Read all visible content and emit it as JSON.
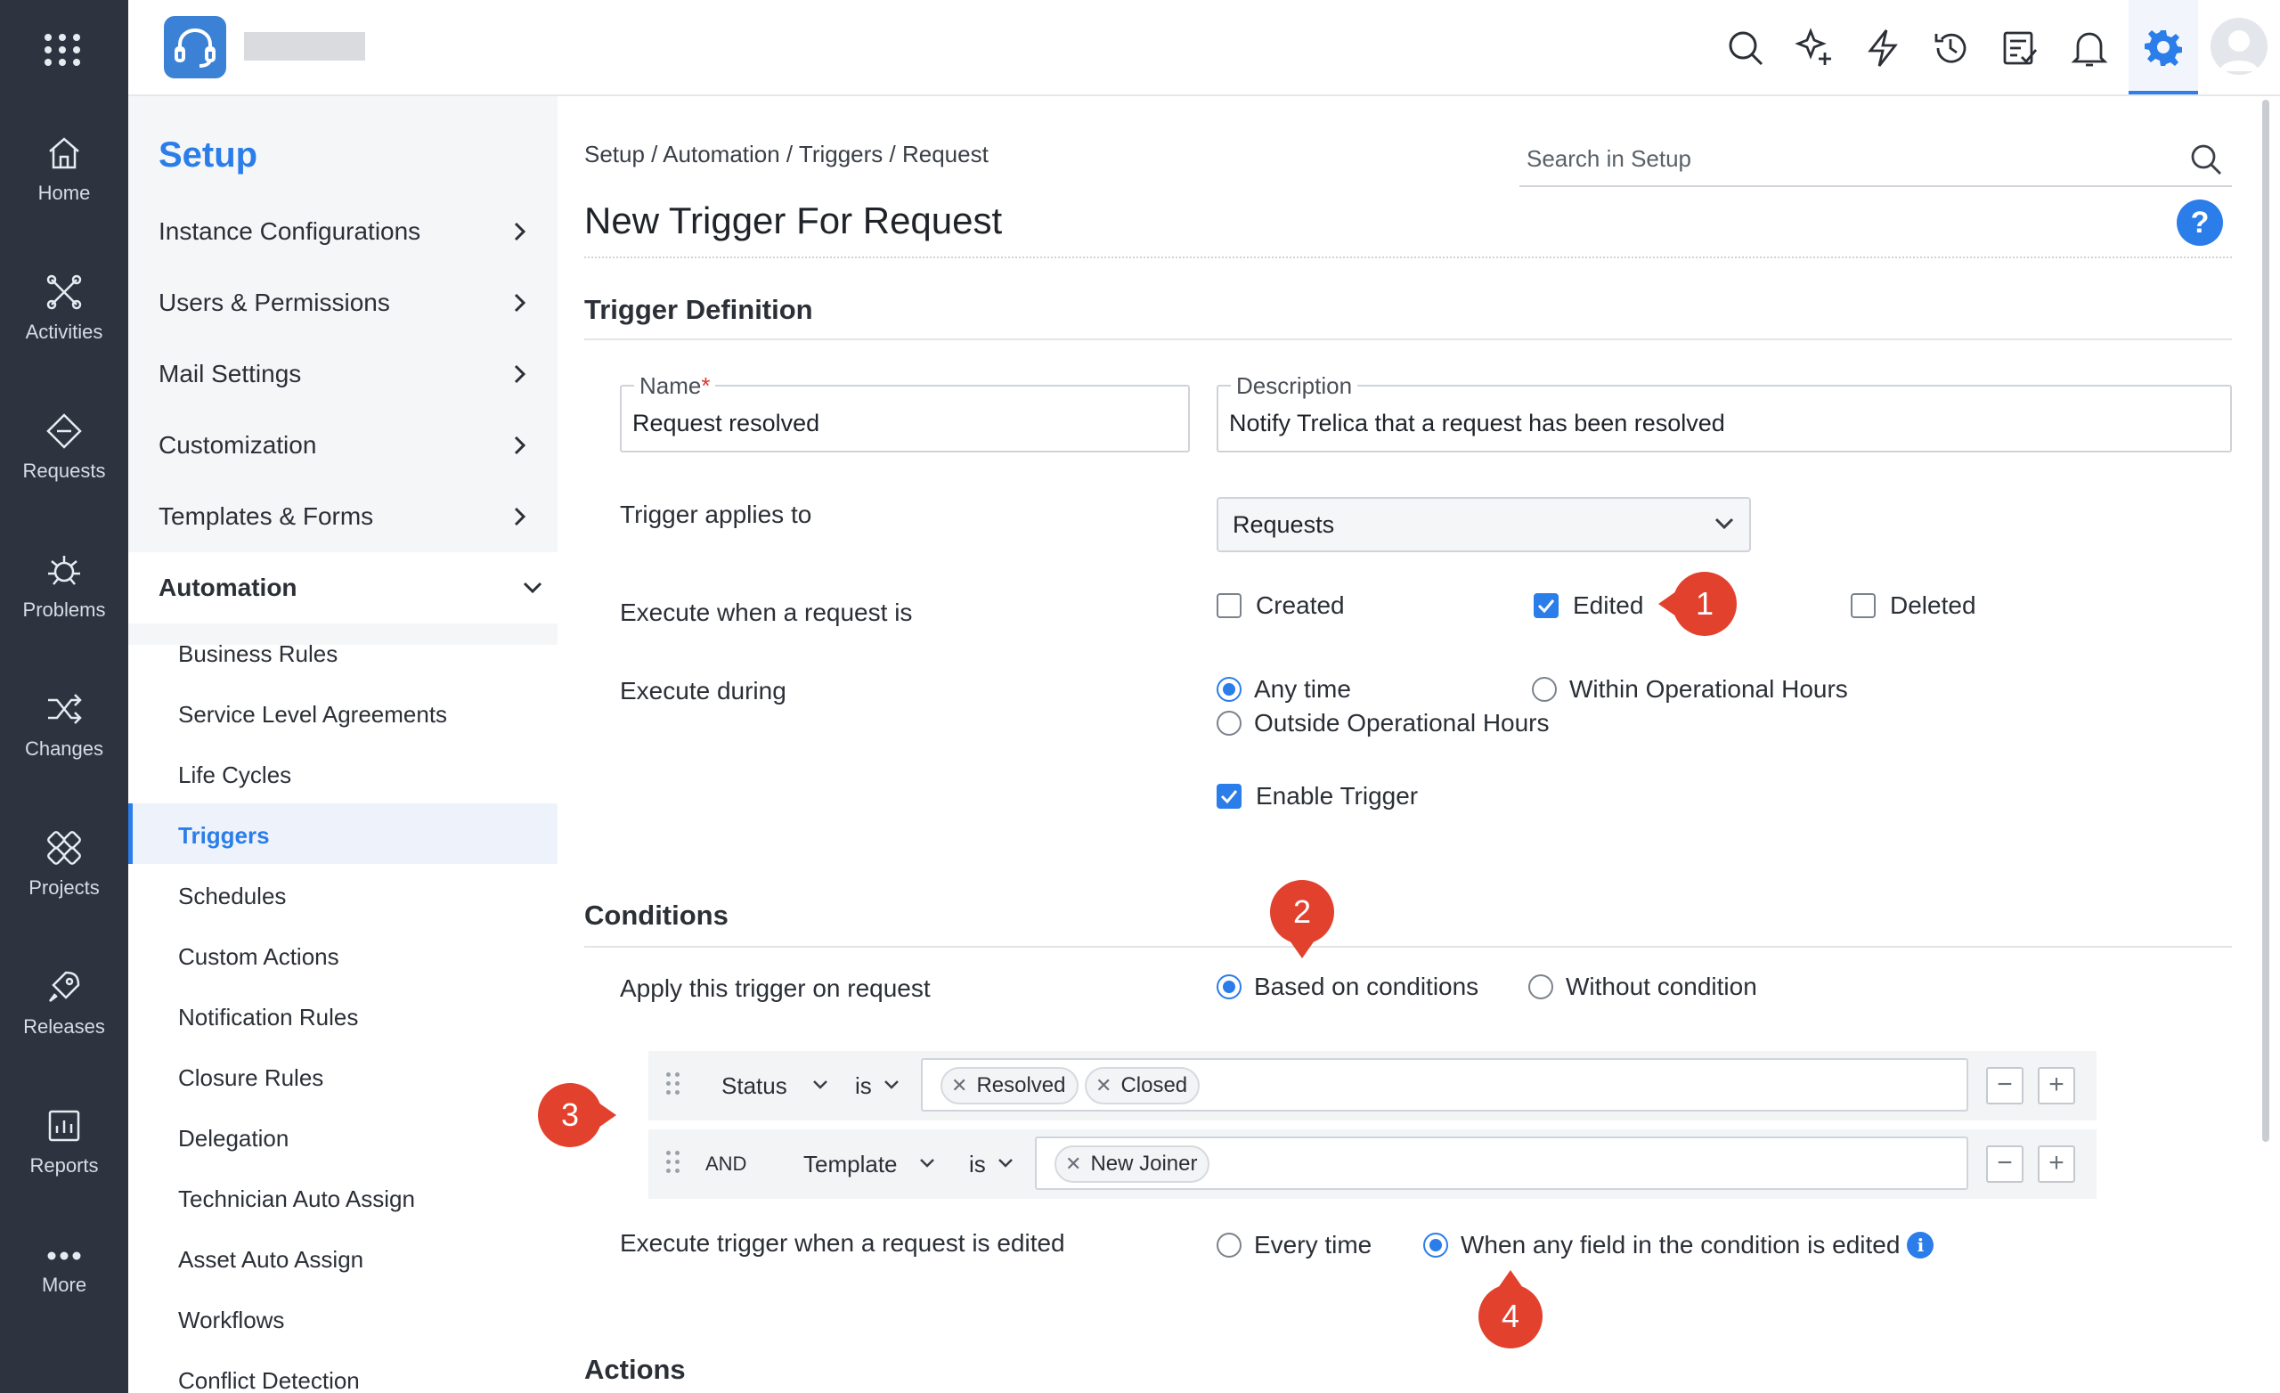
{
  "rail": {
    "items": [
      {
        "label": "Home",
        "icon": "home-icon"
      },
      {
        "label": "Activities",
        "icon": "activities-icon"
      },
      {
        "label": "Requests",
        "icon": "requests-icon"
      },
      {
        "label": "Problems",
        "icon": "problems-icon"
      },
      {
        "label": "Changes",
        "icon": "changes-icon"
      },
      {
        "label": "Projects",
        "icon": "projects-icon"
      },
      {
        "label": "Releases",
        "icon": "releases-icon"
      },
      {
        "label": "Reports",
        "icon": "reports-icon"
      },
      {
        "label": "More",
        "icon": "more-icon"
      }
    ]
  },
  "topbar": {
    "icons": [
      "search-icon",
      "ai-sparkle-icon",
      "quick-actions-icon",
      "history-icon",
      "tasks-icon",
      "notifications-icon",
      "settings-icon",
      "user-avatar"
    ],
    "accent": "#2f7fe6"
  },
  "setup": {
    "title": "Setup",
    "menu": [
      {
        "label": "Instance Configurations"
      },
      {
        "label": "Users & Permissions"
      },
      {
        "label": "Mail Settings"
      },
      {
        "label": "Customization"
      },
      {
        "label": "Templates & Forms"
      }
    ],
    "automation_label": "Automation",
    "automation_items": [
      {
        "label": "Business Rules"
      },
      {
        "label": "Service Level Agreements"
      },
      {
        "label": "Life Cycles"
      },
      {
        "label": "Triggers"
      },
      {
        "label": "Schedules"
      },
      {
        "label": "Custom Actions"
      },
      {
        "label": "Notification Rules"
      },
      {
        "label": "Closure Rules"
      },
      {
        "label": "Delegation"
      },
      {
        "label": "Technician Auto Assign"
      },
      {
        "label": "Asset Auto Assign"
      },
      {
        "label": "Workflows"
      },
      {
        "label": "Conflict Detection"
      }
    ],
    "active_item": "Triggers"
  },
  "main": {
    "breadcrumb": "Setup / Automation / Triggers / Request",
    "search_placeholder": "Search in Setup",
    "page_title": "New Trigger For Request",
    "help": "?",
    "trigger_definition": {
      "title": "Trigger Definition",
      "name_label": "Name",
      "name_required": "*",
      "name_value": "Request resolved",
      "description_label": "Description",
      "description_value": "Notify Trelica that a request has been resolved",
      "applies_label": "Trigger applies to",
      "applies_value": "Requests",
      "execute_when_label": "Execute when a request is",
      "execute_when": [
        {
          "label": "Created",
          "checked": false
        },
        {
          "label": "Edited",
          "checked": true
        },
        {
          "label": "Deleted",
          "checked": false
        }
      ],
      "execute_during_label": "Execute during",
      "execute_during": [
        {
          "label": "Any time",
          "selected": true
        },
        {
          "label": "Within Operational Hours",
          "selected": false
        },
        {
          "label": "Outside Operational Hours",
          "selected": false
        }
      ],
      "enable_label": "Enable Trigger",
      "enable_checked": true
    },
    "conditions": {
      "title": "Conditions",
      "apply_label": "Apply this trigger on request",
      "apply_options": [
        {
          "label": "Based on conditions",
          "selected": true
        },
        {
          "label": "Without condition",
          "selected": false
        }
      ],
      "rows": [
        {
          "connector": "",
          "field": "Status",
          "operator": "is",
          "values": [
            "Resolved",
            "Closed"
          ]
        },
        {
          "connector": "AND",
          "field": "Template",
          "operator": "is",
          "values": [
            "New Joiner"
          ]
        }
      ],
      "remove_symbol": "−",
      "add_symbol": "+",
      "edited_label": "Execute trigger when a request is edited",
      "edited_options": [
        {
          "label": "Every time",
          "selected": false
        },
        {
          "label": "When any field in the condition is edited",
          "selected": true
        }
      ],
      "info_symbol": "i"
    },
    "actions": {
      "title": "Actions"
    }
  },
  "markers": [
    "1",
    "2",
    "3",
    "4"
  ],
  "colors": {
    "primary": "#2b7de9",
    "marker": "#e2412e",
    "rail": "#2d3440"
  }
}
